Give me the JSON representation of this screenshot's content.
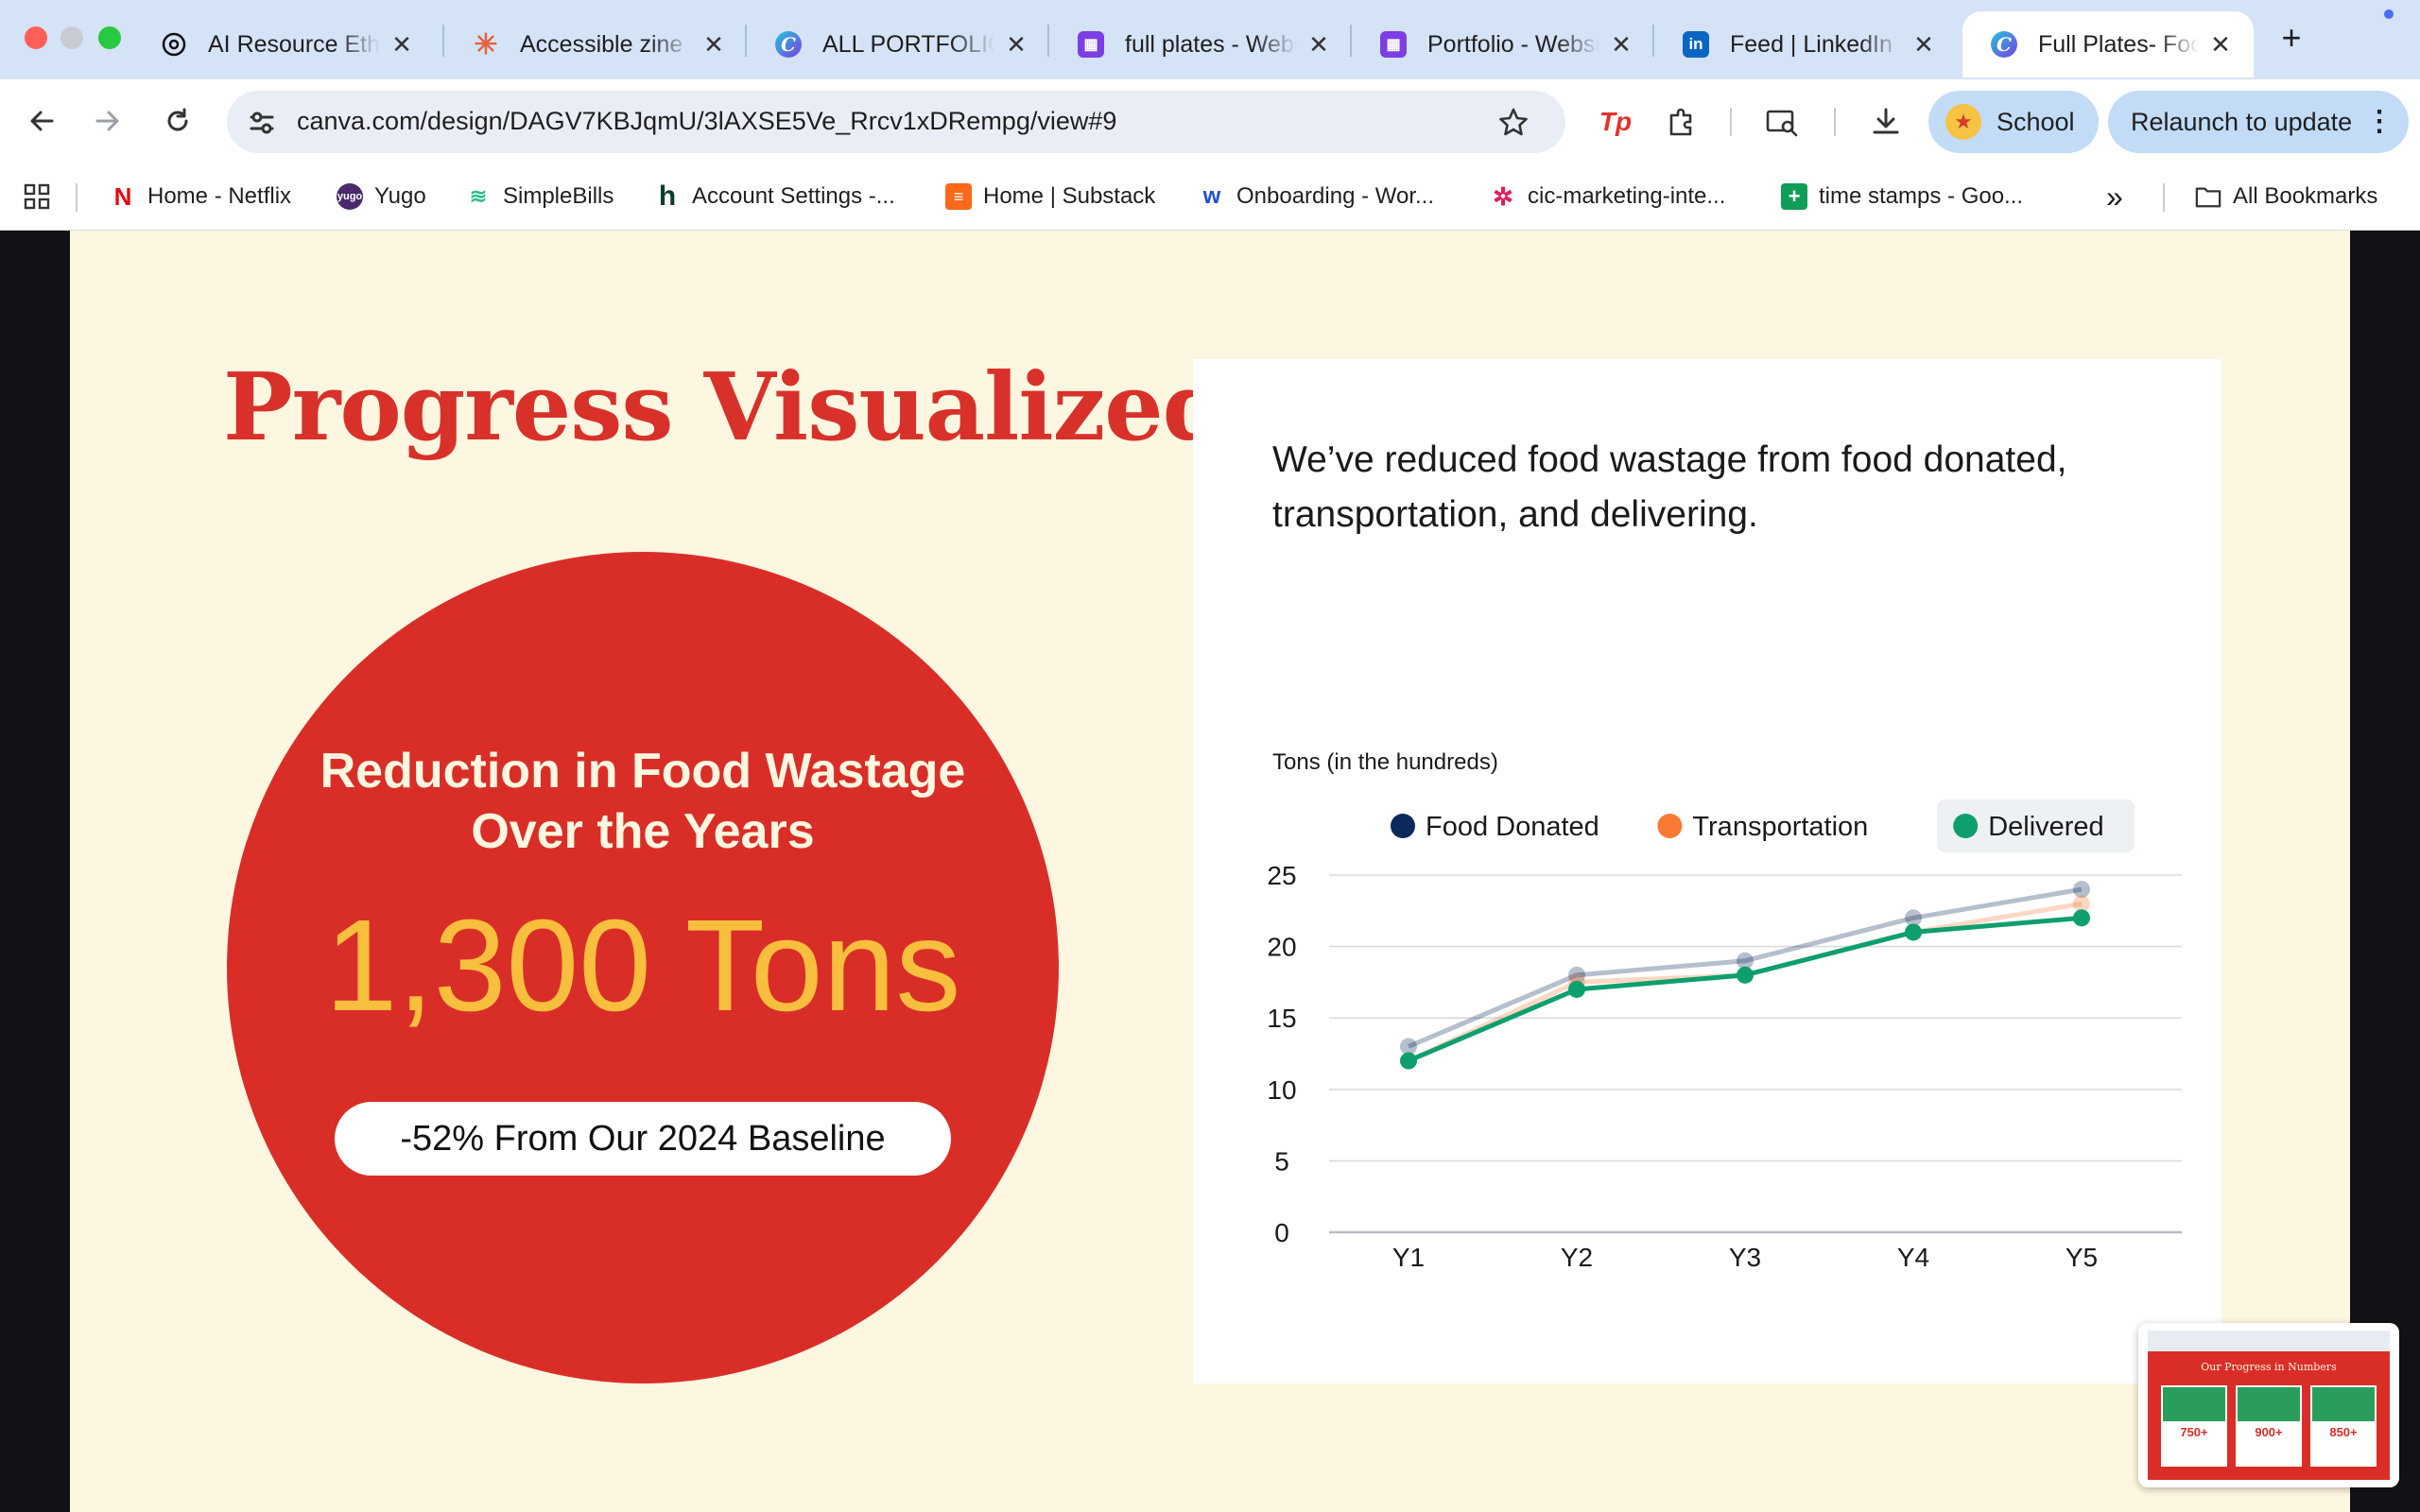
{
  "browser": {
    "tabs": [
      {
        "title": "AI Resource Ethics",
        "favicon": "openai-icon"
      },
      {
        "title": "Accessible zine",
        "favicon": "claude-icon"
      },
      {
        "title": "ALL PORTFOLIO",
        "favicon": "canva-icon"
      },
      {
        "title": "full plates - Website",
        "favicon": "calendar-app-icon"
      },
      {
        "title": "Portfolio - Website",
        "favicon": "calendar-app-icon"
      },
      {
        "title": "Feed | LinkedIn",
        "favicon": "linkedin-icon"
      },
      {
        "title": "Full Plates- Food",
        "favicon": "canva-icon",
        "active": true
      }
    ],
    "new_tab_symbol": "+",
    "url": "canva.com/design/DAGV7KBJqmU/3lAXSE5Ve_Rrcv1xDRempg/view#9",
    "profile_label": "School",
    "relaunch_label": "Relaunch to update",
    "bookmarks": [
      {
        "label": "Home - Netflix",
        "icon": "N",
        "color": "#e50914"
      },
      {
        "label": "Yugo",
        "icon": "Y",
        "color": "#4b2a6b"
      },
      {
        "label": "SimpleBills",
        "icon": "S",
        "color": "#2ebd8c"
      },
      {
        "label": "Account Settings -...",
        "icon": "h",
        "color": "#0b3d2e"
      },
      {
        "label": "Home | Substack",
        "icon": "▤",
        "color": "#ff6719"
      },
      {
        "label": "Onboarding - Wor...",
        "icon": "W",
        "color": "#1f4dd1"
      },
      {
        "label": "cic-marketing-inte...",
        "icon": "✲",
        "color": "#e01e5a"
      },
      {
        "label": "time stamps - Goo...",
        "icon": "+",
        "color": "#0f9d58"
      }
    ],
    "all_bookmarks_label": "All Bookmarks",
    "overflow_symbol": "»"
  },
  "slide": {
    "title": "Progress Visualized",
    "circle": {
      "heading_line1": "Reduction in Food Wastage",
      "heading_line2": "Over the Years",
      "big_number": "1,300 Tons",
      "baseline": "-52% From Our 2024 Baseline"
    },
    "description": "We’ve reduced food wastage from food donated, transportation, and delivering."
  },
  "colors": {
    "brand_red": "#d92e27",
    "cream": "#fdf6e0",
    "gold": "#f8be3d",
    "series_food_donated": "#0b2a5b",
    "series_transportation": "#fa7a35",
    "series_delivered": "#0e9f6e"
  },
  "chart_data": {
    "type": "line",
    "ylabel": "Tons (in the hundreds)",
    "categories": [
      "Y1",
      "Y2",
      "Y3",
      "Y4",
      "Y5"
    ],
    "ylim": [
      0,
      25
    ],
    "yticks": [
      0,
      5,
      10,
      15,
      20,
      25
    ],
    "grid": true,
    "legend_placement": "top",
    "series": [
      {
        "name": "Food Donated",
        "values": [
          13,
          18,
          19,
          22,
          24
        ],
        "color": "#0b2a5b"
      },
      {
        "name": "Transportation",
        "values": [
          12,
          17.5,
          18,
          21,
          23
        ],
        "color": "#fa7a35"
      },
      {
        "name": "Delivered",
        "values": [
          12,
          17,
          18,
          21,
          22
        ],
        "color": "#0e9f6e"
      }
    ],
    "highlighted_series": "Delivered"
  },
  "minimap": {
    "title": "Our Progress in Numbers",
    "stats": [
      "750+",
      "900+",
      "850+"
    ]
  }
}
